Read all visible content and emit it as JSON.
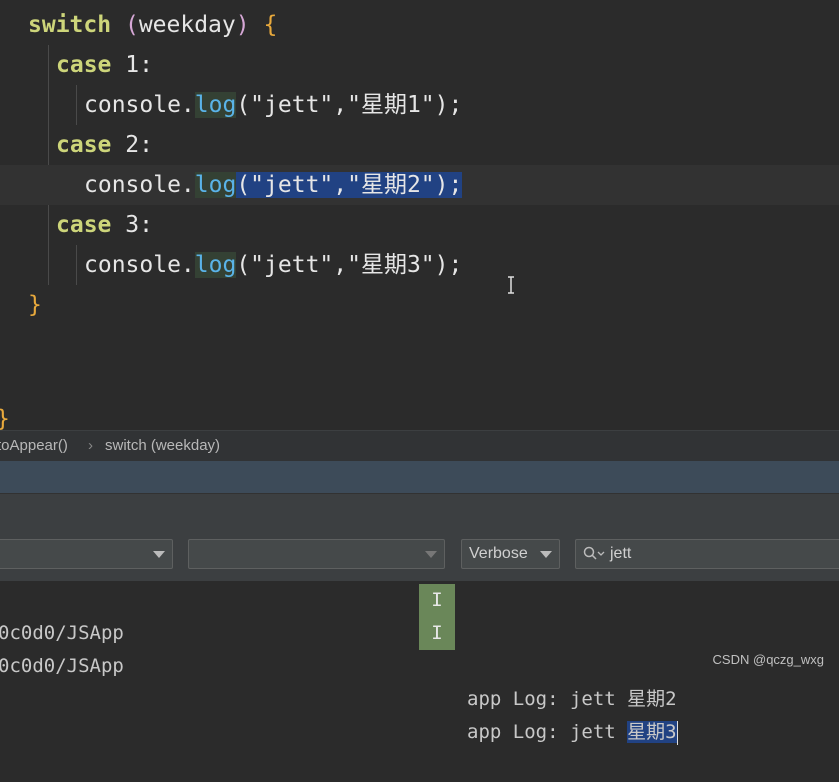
{
  "editor": {
    "lines": [
      {
        "kw": "switch",
        "paren_open": "(",
        "ident": "weekday",
        "paren_close": ")",
        "brace": "{"
      },
      {
        "kw": "case",
        "num": "1:"
      },
      {
        "obj": "console.",
        "fn": "log",
        "args": "(\"jett\",\"星期1\");"
      },
      {
        "kw": "case",
        "num": "2:"
      },
      {
        "obj": "console.",
        "fn": "log",
        "args": "(\"jett\",\"星期2\");"
      },
      {
        "kw": "case",
        "num": "3:"
      },
      {
        "obj": "console.",
        "fn": "log",
        "args": "(\"jett\",\"星期3\");"
      },
      {
        "brace": "}"
      }
    ],
    "outer_brace": "}"
  },
  "breadcrumb": {
    "items": [
      "toAppear()",
      "›",
      "switch (weekday)"
    ]
  },
  "filters": {
    "device_select": "",
    "process_select": "",
    "level_select": "Verbose",
    "search_value": "jett"
  },
  "logs": {
    "rows": [
      {
        "process": "0c0d0/JSApp",
        "level": "I",
        "message": "app Log: jett ",
        "highlight": "星期2"
      },
      {
        "process": "0c0d0/JSApp",
        "level": "I",
        "message": "app Log: jett ",
        "highlight": "星期3"
      }
    ]
  },
  "watermark": "CSDN @qczg_wxg",
  "colors": {
    "editor_bg": "#2b2b2b",
    "keyword": "#cdd57a",
    "function": "#5ab3e8",
    "string": "#b0d08d",
    "selection": "#214283",
    "level_info": "#6a8759"
  }
}
